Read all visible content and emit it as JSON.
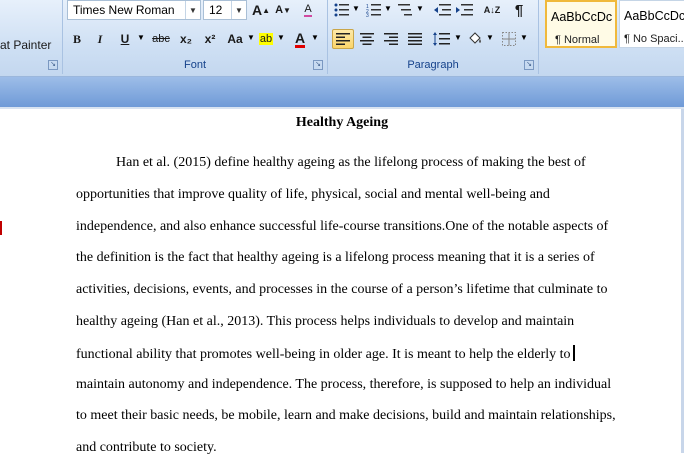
{
  "clipboard": {
    "format_painter_label": "at Painter"
  },
  "font_group": {
    "label": "Font",
    "font_name": "Times New Roman",
    "font_size": "12",
    "buttons": {
      "grow": "A",
      "shrink": "A",
      "clear": "A",
      "bold": "B",
      "italic": "I",
      "underline": "U",
      "strike": "abc",
      "subscript": "x₂",
      "superscript": "x²",
      "case": "Aa",
      "highlight": "ab",
      "font_color": "A"
    }
  },
  "paragraph_group": {
    "label": "Paragraph",
    "buttons": {
      "sort": "A↓Z",
      "pilcrow": "¶"
    }
  },
  "styles": [
    {
      "preview": "AaBbCcDc",
      "name": "¶ Normal",
      "selected": true
    },
    {
      "preview": "AaBbCcDc",
      "name": "¶ No Spaci..."
    }
  ],
  "colors": {
    "highlight": "#ffff00",
    "font_color": "#e00000",
    "accent": "#15428b"
  },
  "document": {
    "title": "Healthy Ageing",
    "lines": [
      "Han et al. (2015) define healthy ageing as the lifelong process of making the best of",
      "opportunities that improve quality of life, physical, social and mental well-being and",
      "independence, and also enhance successful life-course transitions.One of the notable aspects of",
      "the definition is the fact that healthy ageing is a lifelong process meaning that it is a series of",
      "activities, decisions, events, and processes in the course of a person’s lifetime that culminate to",
      "healthy ageing (Han et al., 2013). This process helps individuals to develop and maintain",
      "functional ability that promotes well-being in older age. It is meant to help the elderly to",
      "maintain autonomy and independence. The process, therefore, is supposed to help an individual",
      "to meet their basic needs, be mobile, learn and make decisions, build and maintain relationships,",
      "and contribute to society."
    ]
  }
}
